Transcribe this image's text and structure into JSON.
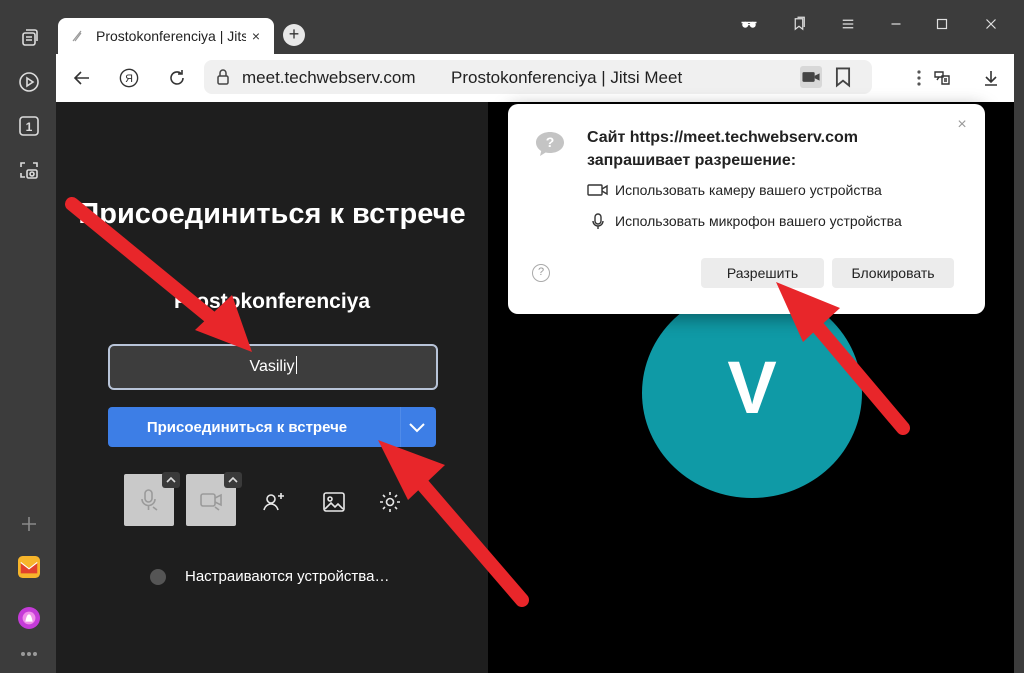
{
  "browser": {
    "tab": {
      "title": "Prostokonferenciya | Jitsi Meet",
      "close_glyph": "×"
    },
    "new_tab_glyph": "+",
    "address": {
      "url": "meet.techwebserv.com",
      "page_title": "Prostokonferenciya | Jitsi Meet"
    },
    "yandex_glyph": "Я"
  },
  "sidebar": {
    "items": [
      {
        "icon": "tabs-icon"
      },
      {
        "icon": "play-icon"
      },
      {
        "icon": "counter-icon",
        "label": "1"
      },
      {
        "icon": "screenshot-icon"
      },
      {
        "icon": "add-icon"
      },
      {
        "icon": "mail-app-icon"
      },
      {
        "icon": "alice-icon"
      },
      {
        "icon": "more-icon"
      }
    ]
  },
  "meeting": {
    "join_title": "Присоединиться к встрече",
    "room_name": "Prostokonferenciya",
    "name_value": "Vasiliy",
    "join_button": "Присоединиться к встрече",
    "status_text": "Настраиваются устройства…",
    "avatar_letter": "V"
  },
  "permission_popup": {
    "title": "Сайт https://meet.techwebserv.com запрашивает разрешение:",
    "camera": "Использовать камеру вашего устройства",
    "microphone": "Использовать микрофон вашего устройства",
    "help_glyph": "?",
    "close_glyph": "×",
    "allow": "Разрешить",
    "block": "Блокировать"
  },
  "colors": {
    "accent_blue": "#3d7ee6",
    "avatar_teal": "#0f9aa6",
    "arrow_red": "#e8262a"
  }
}
